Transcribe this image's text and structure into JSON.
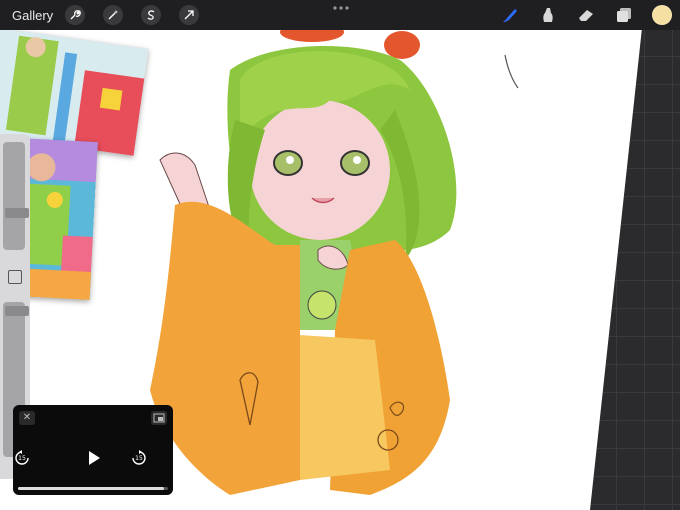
{
  "toolbar": {
    "gallery_label": "Gallery",
    "left_tools": [
      "wrench-icon",
      "magic-wand-icon",
      "selection-icon",
      "transform-arrow-icon"
    ],
    "right_tools": [
      "brush-icon",
      "smudge-icon",
      "eraser-icon",
      "layers-icon"
    ],
    "active_tool": "brush-icon",
    "accent": "#2f6bff",
    "current_color": "#f6dfa2"
  },
  "sidebar": {
    "brush_size_level": 0.55,
    "opacity_level": 0.95
  },
  "pip_player": {
    "skip_back_label": "15",
    "skip_forward_label": "15",
    "progress": 0.97
  }
}
